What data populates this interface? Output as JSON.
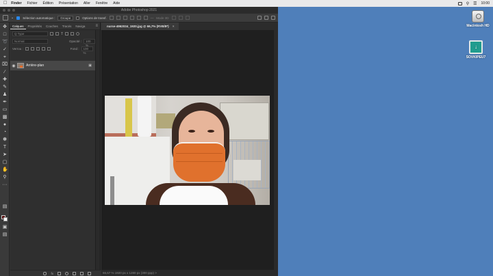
{
  "menubar": {
    "apple": "",
    "items": [
      "Finder",
      "Fichier",
      "Édition",
      "Présentation",
      "Aller",
      "Fenêtre",
      "Aide"
    ],
    "clock": "10:00"
  },
  "window": {
    "title": "Adobe Photoshop 2021"
  },
  "options_bar": {
    "auto_select_label": "Sélection automatique :",
    "auto_select_value": "Groupe",
    "transform_label": "Options de transf.",
    "mode3d_label": "Mode 3D"
  },
  "layers_panel": {
    "tabs": [
      "Calques",
      "Propriétés",
      "Couches",
      "Tracés",
      "Naviga"
    ],
    "kind_filter": "Q Type",
    "blend_mode": "Normal",
    "opacity_label": "Opacité :",
    "opacity_value": "100 %",
    "lock_label": "Verrou :",
    "fill_label": "Fond :",
    "fill_value": "100 %",
    "layers": [
      {
        "name": "Arrière-plan"
      }
    ],
    "footer_fx": "fx"
  },
  "document": {
    "tab_label": "nurse-4962034_1920.jpg @ 66,7% (RVB/8*)",
    "status": "66,67 %   1920 px x 1280 px (300 ppp)  >"
  },
  "desktop": {
    "icons": [
      {
        "label": "Macintosh HD",
        "icon": "hard-drive-icon"
      },
      {
        "label": "SOVKIPEU7",
        "icon": "installer-disk-icon"
      }
    ]
  },
  "colors": {
    "desktop": "#4f7fba",
    "foreground_swatch": "#5a0d0d",
    "background_swatch": "#ffffff",
    "mask": "#e0712d"
  }
}
